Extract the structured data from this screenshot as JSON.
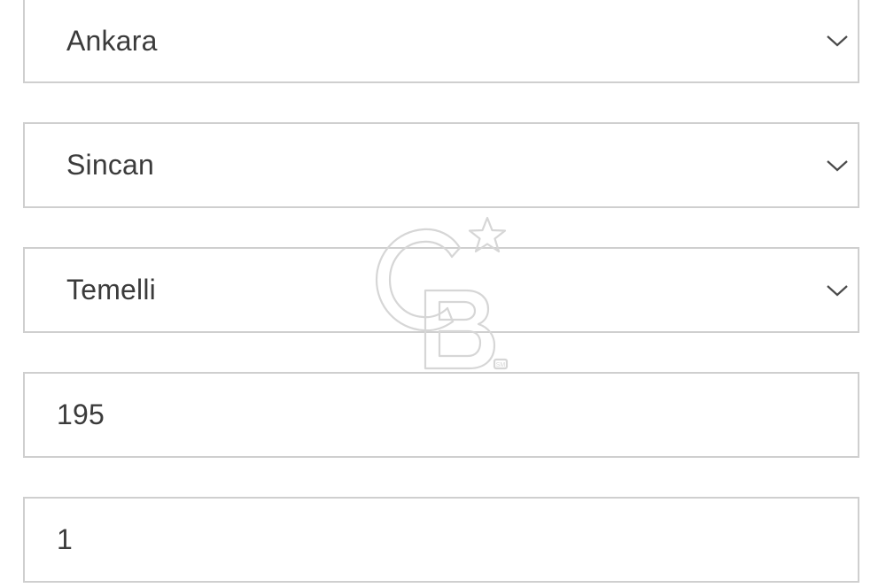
{
  "form": {
    "fields": [
      {
        "type": "select",
        "value": "Ankara"
      },
      {
        "type": "select",
        "value": "Sincan"
      },
      {
        "type": "select",
        "value": "Temelli"
      },
      {
        "type": "input",
        "value": "195"
      },
      {
        "type": "input",
        "value": "1"
      }
    ]
  },
  "watermark": {
    "brand": "CB",
    "mark": "SM",
    "icon": "coldwell-banker-logo",
    "color": "#d6d6d6"
  },
  "icons": {
    "dropdown": "chevron-down-icon"
  },
  "colors": {
    "border": "#cfcfcf",
    "text": "#3b3b3b",
    "background": "#ffffff"
  }
}
